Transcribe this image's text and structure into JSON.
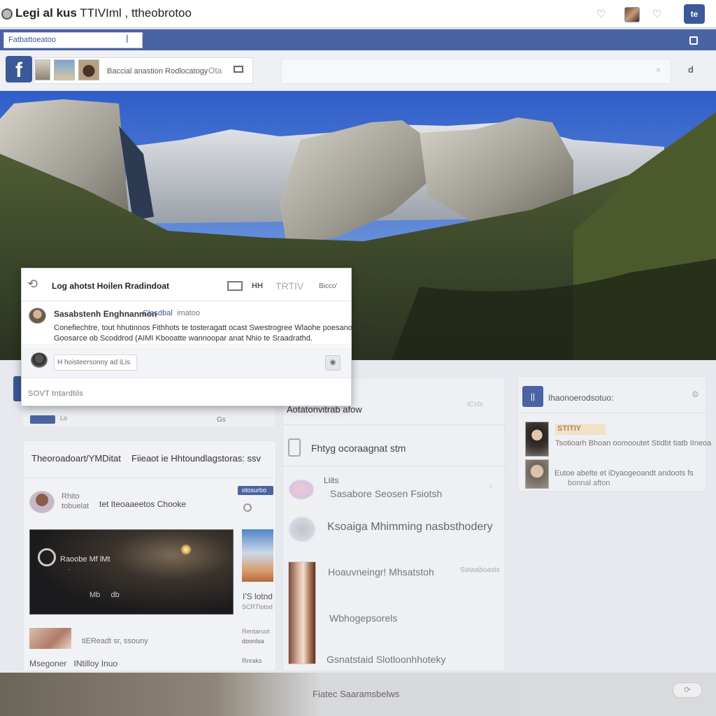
{
  "browser": {
    "title_bold": "Legi al kus",
    "title_rest": " TTIVIml , ttheobrotoo",
    "heart_icon": "heart-icon",
    "account_button": "te"
  },
  "bluebar": {
    "tab_label": "Fatbattoeatoo",
    "tab_icon": "ꟾ"
  },
  "nav": {
    "logo": "f",
    "text": "Baccial anastion Rodlocatogy",
    "text2": "Ota",
    "search_clear": "×",
    "right_icon": "d"
  },
  "popup": {
    "title": "Log ahotst Hoilen Rradindoat",
    "hh": "HH",
    "tv": "TRTIV",
    "count": "Bicco'",
    "author": "Sasabstenh Enghnanmon",
    "tag": "Clasdbal",
    "tag2": "imatoo",
    "line1": "Conefiechtre, tout hhutinnos Fithhots te tosteragatt ocast Swestrogree Wlaohe poesanomaddd",
    "line2": "Goosarce ob Scoddrod (AIMI Kbooatte wannoopar anat Nhio te Sraadrathd.",
    "comment_placeholder": "H hoisteersonny ad iLis",
    "footer": "SOVT tntardtils"
  },
  "left": {
    "tag_text": "Lo",
    "num": "Gs",
    "header": "Theoroadoart/YMDitat",
    "header2": "Fiieaot ie Hhtoundlagstoras: ssv",
    "name1": "Rhito",
    "name2": "tobuelat",
    "name3": "tet Iteoaaeetos Chooke",
    "btn": "otosurbo",
    "video_title": "Raoobe Mf lMt",
    "video_sub": "  ..     ",
    "video_ctrl": "Mb     db",
    "side1": "I'S lotnd",
    "side2": "SCRTlotod",
    "small_text": "tiEReadt sr, ssouny",
    "side3": "Rentaruot",
    "side4": "doonlsa",
    "side5": "Rnraks",
    "foot": "Msegoner   INtilloy Inuo"
  },
  "middle": {
    "title": "Aotatonvitrab afow",
    "ghost": "ICsts",
    "row1": "Fhtyg ocoraagnat stm",
    "row2a": "Liits",
    "row2b": "Sasabore Seosen Fsiotsh",
    "row2c": "›",
    "row3": "Ksoaiga Mhimming nasbsthodery",
    "row4": "Hoauvneingr! Mhsatstoh",
    "row4b": "Sstwaboasts",
    "row5": "Wbhogepsorels",
    "row6": "Gsnatstaid Slotloonhhoteky"
  },
  "right": {
    "icon": "||",
    "title": "Ihaonoerodsotuo:",
    "gear": "⚙",
    "badge": "STITIY",
    "t1": "Tsotioarh Bhoan oomooutet Stidbt tiatb IIneoa",
    "t2": "Eutoe abelte et iDyaogeoandt andoots fs",
    "t3": "bonnal afton"
  },
  "bottom": {
    "text": "Fiatec Saaramsbelws",
    "btn": "⟳"
  },
  "colors": {
    "brand_blue": "#3b5998",
    "bar_blue": "#4a63a2",
    "sky": "#2f5ec9"
  }
}
